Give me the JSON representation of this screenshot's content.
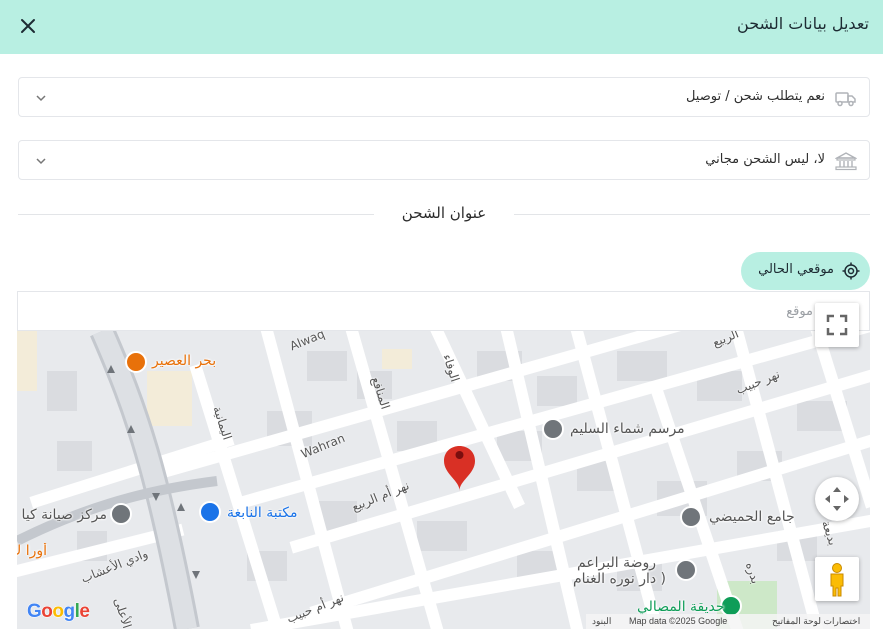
{
  "header": {
    "title": "تعديل بيانات الشحن"
  },
  "shipping_required": {
    "value": "نعم يتطلب شحن / توصيل",
    "icon": "truck-icon"
  },
  "free_shipping": {
    "value": "لا، ليس الشحن مجاني",
    "icon": "bank-icon"
  },
  "section": {
    "title": "عنوان الشحن"
  },
  "current_location_button": {
    "label": "موقعي الحالي",
    "icon": "crosshair-icon"
  },
  "location_input": {
    "placeholder": "موقع",
    "value": ""
  },
  "map": {
    "pois": [
      {
        "name": "بحر العصير",
        "color": "#e8710a"
      },
      {
        "name": "مرسم شماء السليم",
        "color": "#555555"
      },
      {
        "name": "مكتبة النابغة",
        "color": "#1a73e8"
      },
      {
        "name": "مركز صيانة كيا",
        "color": "#555555"
      },
      {
        "name": "جامع الحميضي",
        "color": "#555555"
      },
      {
        "name": "روضة البراعم",
        "color": "#555555"
      },
      {
        "name": "( دار نوره الغنام",
        "color": "#555555"
      },
      {
        "name": "حديقة المصالي",
        "color": "#0f9d58"
      },
      {
        "name": "أورا ك",
        "color": "#e8710a"
      }
    ],
    "streets": [
      "Alwaq",
      "Wahran",
      "الوفاء",
      "المنافع",
      "اليمانية",
      "نهر أم الربيع",
      "نهر أم حبيب",
      "نهر حبيب",
      "الربيع",
      "وادي الأعشاب",
      "الأعلى",
      "بدره",
      "بديعة"
    ],
    "google_logo": "Google",
    "attribution": {
      "shortcuts": "اختصارات لوحة المفاتيح",
      "map_data": "Map data ©2025 Google",
      "terms": "البنود"
    }
  },
  "colors": {
    "accent": "#b8efe2",
    "marker": "#d93025"
  }
}
